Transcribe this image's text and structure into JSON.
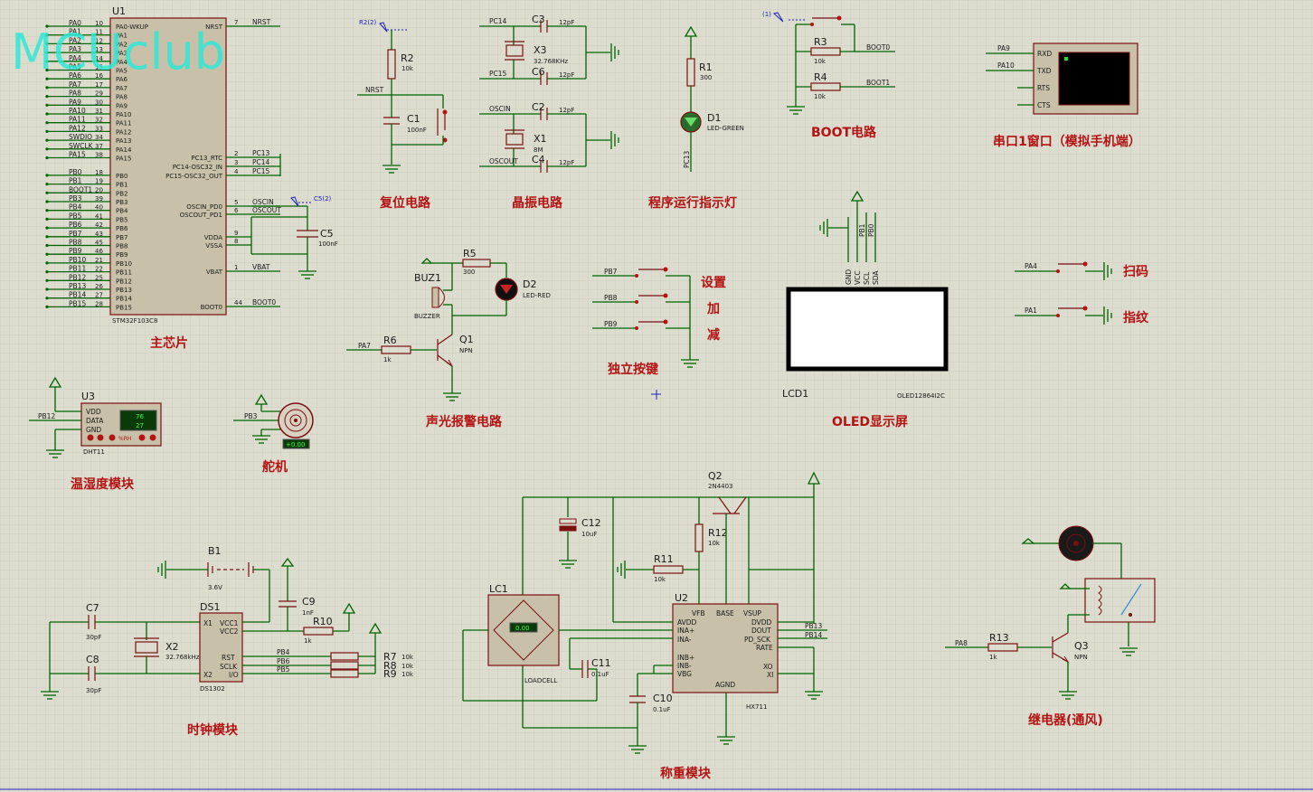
{
  "watermark": "MCUclub",
  "titles": {
    "main_chip": "主芯片",
    "reset": "复位电路",
    "crystal": "晶振电路",
    "indicator": "程序运行指示灯",
    "boot": "BOOT电路",
    "uart": "串口1窗口（模拟手机端）",
    "alarm": "声光报警电路",
    "keys": "独立按键",
    "oled": "OLED显示屏",
    "servo": "舵机",
    "dht": "温湿度模块",
    "clock": "时钟模块",
    "weigh": "称重模块",
    "relay": "继电器(通风)"
  },
  "u1": {
    "ref": "U1",
    "part": "STM32F103C8",
    "left_pins": [
      {
        "net": "PA0",
        "num": "10",
        "name": "PA0-WKUP"
      },
      {
        "net": "PA1",
        "num": "11",
        "name": "PA1"
      },
      {
        "net": "PA2",
        "num": "12",
        "name": "PA2"
      },
      {
        "net": "PA3",
        "num": "13",
        "name": "PA3"
      },
      {
        "net": "PA4",
        "num": "14",
        "name": "PA4"
      },
      {
        "net": "PA5",
        "num": "15",
        "name": "PA5"
      },
      {
        "net": "PA6",
        "num": "16",
        "name": "PA6"
      },
      {
        "net": "PA7",
        "num": "17",
        "name": "PA7"
      },
      {
        "net": "PA8",
        "num": "29",
        "name": "PA8"
      },
      {
        "net": "PA9",
        "num": "30",
        "name": "PA9"
      },
      {
        "net": "PA10",
        "num": "31",
        "name": "PA10"
      },
      {
        "net": "PA11",
        "num": "32",
        "name": "PA11"
      },
      {
        "net": "PA12",
        "num": "33",
        "name": "PA12"
      },
      {
        "net": "SWDIO",
        "num": "34",
        "name": "PA13"
      },
      {
        "net": "SWCLK",
        "num": "37",
        "name": "PA14"
      },
      {
        "net": "PA15",
        "num": "38",
        "name": "PA15"
      },
      {
        "net": "",
        "num": "",
        "name": ""
      },
      {
        "net": "PB0",
        "num": "18",
        "name": "PB0"
      },
      {
        "net": "PB1",
        "num": "19",
        "name": "PB1"
      },
      {
        "net": "BOOT1",
        "num": "20",
        "name": "PB2"
      },
      {
        "net": "PB3",
        "num": "39",
        "name": "PB3"
      },
      {
        "net": "PB4",
        "num": "40",
        "name": "PB4"
      },
      {
        "net": "PB5",
        "num": "41",
        "name": "PB5"
      },
      {
        "net": "PB6",
        "num": "42",
        "name": "PB6"
      },
      {
        "net": "PB7",
        "num": "43",
        "name": "PB7"
      },
      {
        "net": "PB8",
        "num": "45",
        "name": "PB8"
      },
      {
        "net": "PB9",
        "num": "46",
        "name": "PB9"
      },
      {
        "net": "PB10",
        "num": "21",
        "name": "PB10"
      },
      {
        "net": "PB11",
        "num": "22",
        "name": "PB11"
      },
      {
        "net": "PB12",
        "num": "25",
        "name": "PB12"
      },
      {
        "net": "PB13",
        "num": "26",
        "name": "PB13"
      },
      {
        "net": "PB14",
        "num": "27",
        "name": "PB14"
      },
      {
        "net": "PB15",
        "num": "28",
        "name": "PB15"
      }
    ],
    "right_pins": [
      {
        "name": "NRST",
        "num": "7",
        "net": "NRST"
      },
      {
        "name": "PC13_RTC",
        "num": "2",
        "net": "PC13"
      },
      {
        "name": "PC14-OSC32_IN",
        "num": "3",
        "net": "PC14"
      },
      {
        "name": "PC15-OSC32_OUT",
        "num": "4",
        "net": "PC15"
      },
      {
        "name": "OSCIN_PD0",
        "num": "5",
        "net": "OSCIN"
      },
      {
        "name": "OSCOUT_PD1",
        "num": "6",
        "net": "OSCOUT"
      },
      {
        "name": "VDDA",
        "num": "9",
        "net": ""
      },
      {
        "name": "VSSA",
        "num": "8",
        "net": ""
      },
      {
        "name": "VBAT",
        "num": "1",
        "net": "VBAT"
      },
      {
        "name": "BOOT0",
        "num": "44",
        "net": "BOOT0"
      }
    ]
  },
  "reset": {
    "r_ref": "R2",
    "r_val": "10k",
    "c_ref": "C1",
    "c_val": "100nF",
    "net": "NRST",
    "probe": "R2(2)"
  },
  "c5": {
    "ref": "C5",
    "val": "100nF",
    "probe": "C5(2)"
  },
  "crystal": {
    "c3": "C3",
    "c3v": "12pF",
    "c6": "C6",
    "c6v": "12pF",
    "x3": "X3",
    "x3v": "32.768KHz",
    "c2": "C2",
    "c2v": "12pF",
    "c4": "C4",
    "c4v": "12pF",
    "x1": "X1",
    "x1v": "8M",
    "n_pc14": "PC14",
    "n_pc15": "PC15",
    "n_oscin": "OSCIN",
    "n_oscout": "OSCOUT"
  },
  "indicator": {
    "r": "R1",
    "rv": "300",
    "d": "D1",
    "dv": "LED-GREEN",
    "net": "PC13"
  },
  "boot": {
    "probe": "(1)",
    "r3": "R3",
    "r3v": "10k",
    "r4": "R4",
    "r4v": "10k",
    "n0": "BOOT0",
    "n1": "BOOT1"
  },
  "uart": {
    "pins": [
      "RXD",
      "TXD",
      "RTS",
      "CTS"
    ],
    "nets": [
      "PA9",
      "PA10"
    ]
  },
  "alarm": {
    "buz": "BUZ1",
    "buzv": "BUZZER",
    "r5": "R5",
    "r5v": "300",
    "d2": "D2",
    "d2v": "LED-RED",
    "r6": "R6",
    "r6v": "1k",
    "q1": "Q1",
    "q1v": "NPN",
    "net": "PA7"
  },
  "keys": {
    "nets": [
      "PB7",
      "PB8",
      "PB9"
    ],
    "labels": [
      "设置",
      "加",
      "减"
    ]
  },
  "oled": {
    "ref": "LCD1",
    "part": "OLED12864I2C",
    "pins": [
      "GND",
      "VCC",
      "SCL",
      "SDA"
    ],
    "nets": [
      "PB1",
      "PB0"
    ]
  },
  "side_keys": {
    "nets": [
      "PA4",
      "PA1"
    ],
    "labels": [
      "扫码",
      "指纹"
    ]
  },
  "dht": {
    "ref": "U3",
    "part": "DHT11",
    "pins": [
      "VDD",
      "DATA",
      "GND"
    ],
    "net": "PB12",
    "temp": "76",
    "hum": "27",
    "rh": "%RH"
  },
  "servo": {
    "net": "PB3",
    "disp": "+0.00"
  },
  "clock": {
    "b1": "B1",
    "b1v": "3.6V",
    "c9": "C9",
    "c9v": "1nF",
    "r10": "R10",
    "r10v": "1k",
    "c7": "C7",
    "c7v": "30pF",
    "c8": "C8",
    "c8v": "30pF",
    "x2": "X2",
    "x2v": "32.768kHz",
    "ds": "DS1",
    "dsv": "DS1302",
    "dspins_l": [
      "X1",
      "X2"
    ],
    "dspins_r": [
      "VCC1",
      "VCC2",
      "RST",
      "SCLK",
      "I/O"
    ],
    "nets": [
      "PB4",
      "PB6",
      "PB5"
    ],
    "r": [
      "R7",
      "R8",
      "R9"
    ],
    "rv": "10k"
  },
  "weigh": {
    "lc": "LC1",
    "lcv": "LOADCELL",
    "lcd": "0.00",
    "c12": "C12",
    "c12v": "10uF",
    "c11": "C11",
    "c11v": "0.1uF",
    "c10": "C10",
    "c10v": "0.1uF",
    "r11": "R11",
    "r11v": "10k",
    "r12": "R12",
    "r12v": "10k",
    "q2": "Q2",
    "q2v": "2N4403",
    "u2": "U2",
    "u2v": "HX711",
    "u2l": [
      "AVDD",
      "INA+",
      "INA-",
      "INB+",
      "INB-",
      "VBG"
    ],
    "u2t": [
      "VFB",
      "BASE",
      "VSUP"
    ],
    "u2r": [
      "DVDD",
      "DOUT",
      "PD_SCK",
      "RATE",
      "XO",
      "XI"
    ],
    "u2b": "AGND",
    "nets": [
      "PB13",
      "PB14"
    ]
  },
  "relay": {
    "r": "R13",
    "rv": "1k",
    "q": "Q3",
    "qv": "NPN",
    "net": "PA8"
  }
}
